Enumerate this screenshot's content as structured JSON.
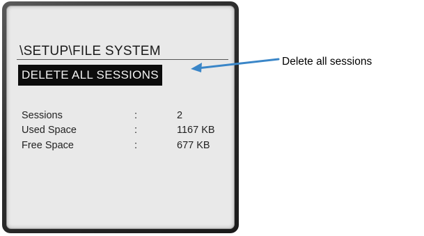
{
  "screen": {
    "path_title": "\\SETUP\\FILE SYSTEM",
    "selected_item": "DELETE ALL SESSIONS",
    "info": [
      {
        "label": "Sessions",
        "colon": ":",
        "value": "2"
      },
      {
        "label": "Used Space",
        "colon": ":",
        "value": "1167 KB"
      },
      {
        "label": "Free Space",
        "colon": ":",
        "value": "677 KB"
      }
    ]
  },
  "annotation": {
    "text": "Delete all sessions",
    "arrow_color": "#3a86c8"
  }
}
